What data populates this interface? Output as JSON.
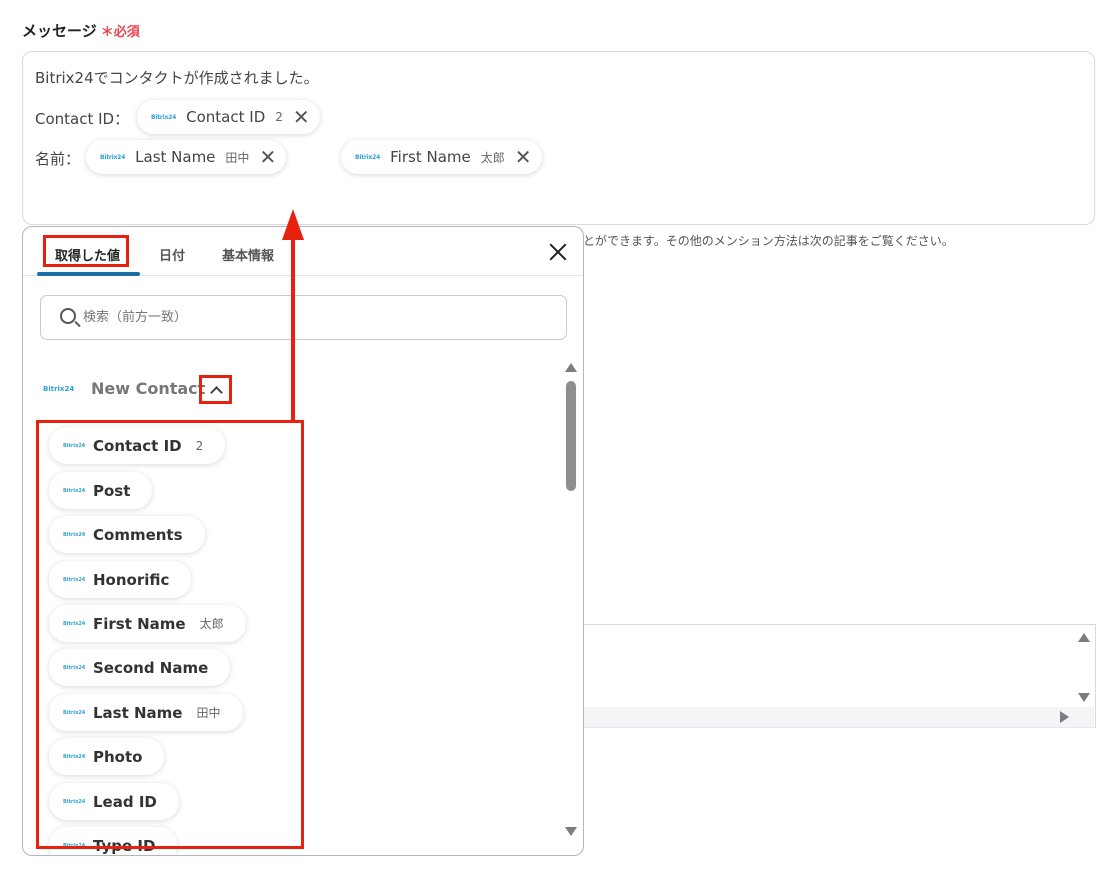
{
  "field": {
    "label": "メッセージ",
    "required": "＊必須"
  },
  "message": {
    "line1": "Bitrix24でコンタクトが作成されました。",
    "line2_label": "Contact ID：",
    "line3_label": "名前：",
    "chips": [
      {
        "name": "Contact ID",
        "value": "2",
        "logo": "Bitrix24"
      },
      {
        "name": "Last Name",
        "value": "田中",
        "logo": "Bitrix24"
      },
      {
        "name": "First Name",
        "value": "太郎",
        "logo": "Bitrix24"
      }
    ]
  },
  "hint": "とができます。その他のメンション方法は次の記事をご覧ください。",
  "popup": {
    "tabs": [
      "取得した値",
      "日付",
      "基本情報"
    ],
    "search_placeholder": "検索（前方一致）",
    "group": {
      "logo": "Bitrix24",
      "title": "New Contact"
    },
    "items": [
      {
        "name": "Contact ID",
        "value": "2"
      },
      {
        "name": "Post",
        "value": ""
      },
      {
        "name": "Comments",
        "value": ""
      },
      {
        "name": "Honorific",
        "value": ""
      },
      {
        "name": "First Name",
        "value": "太郎"
      },
      {
        "name": "Second Name",
        "value": ""
      },
      {
        "name": "Last Name",
        "value": "田中"
      },
      {
        "name": "Photo",
        "value": ""
      },
      {
        "name": "Lead ID",
        "value": ""
      },
      {
        "name": "Type ID",
        "value": ""
      }
    ],
    "item_logo": "Bitrix24"
  },
  "colors": {
    "accent": "#1d6fa3",
    "highlight": "#e8210f",
    "required": "#e5484d",
    "logo": "#2fa3d8"
  }
}
